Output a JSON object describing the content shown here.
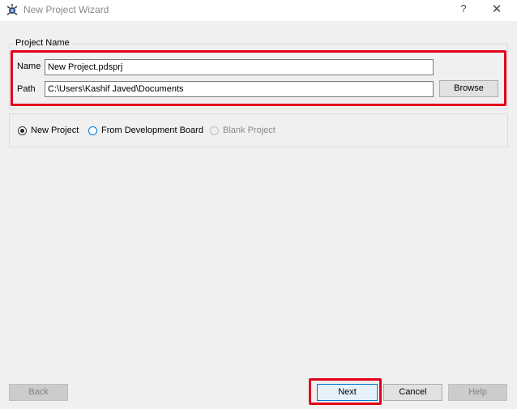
{
  "window": {
    "title": "New Project Wizard",
    "help_label": "?",
    "close_label": "✕"
  },
  "project_name": {
    "group_title": "Project Name",
    "name_label": "Name",
    "name_value": "New Project.pdsprj",
    "path_label": "Path",
    "path_value": "C:\\Users\\Kashif Javed\\Documents",
    "browse_label": "Browse"
  },
  "project_type": {
    "options": [
      {
        "label": "New Project",
        "checked": true,
        "enabled": true
      },
      {
        "label": "From Development Board",
        "checked": false,
        "enabled": true
      },
      {
        "label": "Blank Project",
        "checked": false,
        "enabled": false
      }
    ]
  },
  "footer": {
    "back_label": "Back",
    "next_label": "Next",
    "cancel_label": "Cancel",
    "help_label": "Help"
  },
  "colors": {
    "highlight_red": "#e0001b",
    "accent_blue": "#0078d7"
  }
}
